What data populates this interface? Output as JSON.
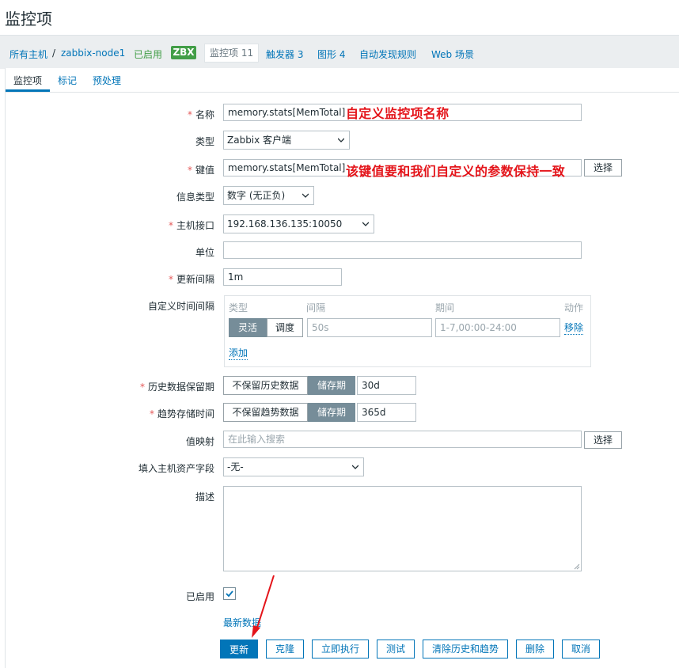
{
  "page": {
    "title": "监控项"
  },
  "breadcrumb": {
    "all_hosts": "所有主机",
    "separator": "/",
    "host": "zabbix-node1",
    "status": "已启用",
    "badge": "ZBX",
    "items": {
      "label": "监控项",
      "count": "11"
    },
    "triggers": {
      "label": "触发器",
      "count": "3"
    },
    "graphs": {
      "label": "图形",
      "count": "4"
    },
    "discovery": "自动发现规则",
    "web": "Web 场景"
  },
  "tabs": {
    "items": "监控项",
    "tags": "标记",
    "preprocessing": "预处理"
  },
  "form": {
    "name": {
      "label": "名称",
      "value": "memory.stats[MemTotal]"
    },
    "type": {
      "label": "类型",
      "value": "Zabbix 客户端"
    },
    "key": {
      "label": "键值",
      "value": "memory.stats[MemTotal]",
      "select_button": "选择"
    },
    "value_type": {
      "label": "信息类型",
      "value": "数字 (无正负)"
    },
    "interface": {
      "label": "主机接口",
      "value": "192.168.136.135:10050"
    },
    "units": {
      "label": "单位",
      "value": ""
    },
    "delay": {
      "label": "更新间隔",
      "value": "1m"
    },
    "custom_intervals": {
      "label": "自定义时间间隔",
      "col_type": "类型",
      "col_interval": "间隔",
      "col_period": "期间",
      "col_action": "动作",
      "flexible": "灵活",
      "scheduling": "调度",
      "interval_placeholder": "50s",
      "period_placeholder": "1-7,00:00-24:00",
      "remove": "移除",
      "add": "添加"
    },
    "history": {
      "label": "历史数据保留期",
      "off": "不保留历史数据",
      "on": "储存期",
      "value": "30d"
    },
    "trends": {
      "label": "趋势存储时间",
      "off": "不保留趋势数据",
      "on": "储存期",
      "value": "365d"
    },
    "valuemap": {
      "label": "值映射",
      "placeholder": "在此输入搜索",
      "select_button": "选择"
    },
    "inventory": {
      "label": "填入主机资产字段",
      "value": "-无-"
    },
    "description": {
      "label": "描述",
      "value": ""
    },
    "enabled": {
      "label": "已启用",
      "checked": true
    },
    "latest_data": "最新数据"
  },
  "buttons": {
    "update": "更新",
    "clone": "克隆",
    "execute_now": "立即执行",
    "test": "测试",
    "clear_history": "清除历史和趋势",
    "delete": "删除",
    "cancel": "取消"
  },
  "annotations": {
    "name_note": "自定义监控项名称",
    "key_note": "该键值要和我们自定义的参数保持一致"
  },
  "colors": {
    "accent": "#0275b8",
    "enabled_green": "#429e47",
    "annotation_red": "#e4141a",
    "required_red": "#e45959"
  }
}
